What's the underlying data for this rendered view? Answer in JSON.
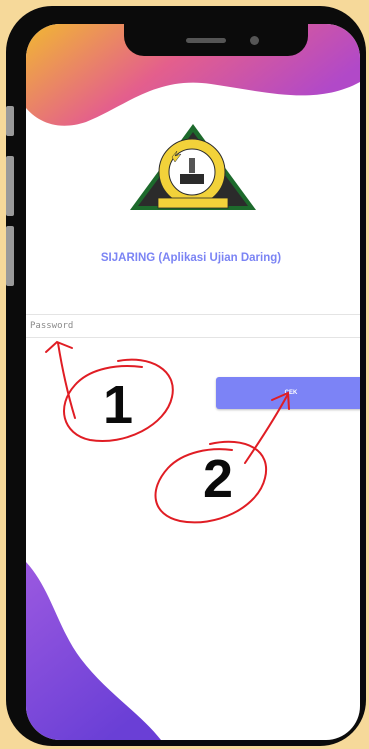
{
  "app": {
    "title": "SIJARING (Aplikasi Ujian Daring)"
  },
  "logo": {
    "top_text": "SMK NEGERI 2 KURIPAN LOMBOK BARAT",
    "bottom_text": "PROVINSI NTB"
  },
  "form": {
    "password_placeholder": "Password",
    "password_value": "",
    "submit_label": "CEK"
  },
  "annotations": {
    "step1": "1",
    "step2": "2"
  },
  "colors": {
    "accent": "#7c83f6",
    "annotation": "#e01d24",
    "background": "#f6d99a"
  }
}
